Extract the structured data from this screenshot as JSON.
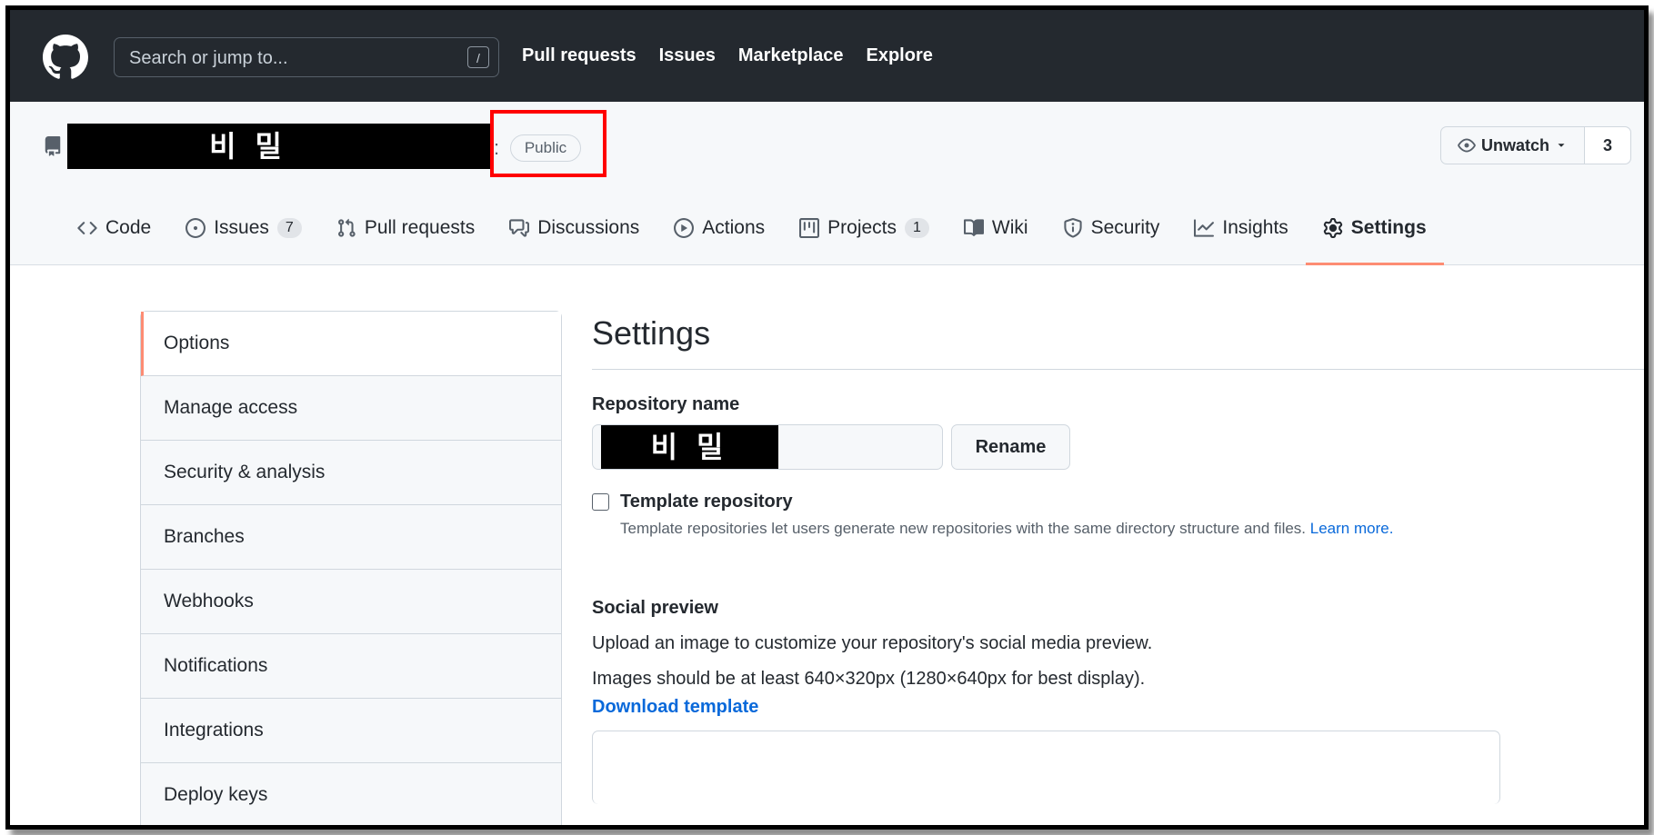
{
  "topbar": {
    "search_placeholder": "Search or jump to...",
    "search_shortcut": "/",
    "nav": [
      "Pull requests",
      "Issues",
      "Marketplace",
      "Explore"
    ]
  },
  "repo": {
    "name_redacted": "비 밀",
    "visibility": "Public",
    "watch_label": "Unwatch",
    "watch_count": "3"
  },
  "tabs": [
    {
      "label": "Code"
    },
    {
      "label": "Issues",
      "count": "7"
    },
    {
      "label": "Pull requests"
    },
    {
      "label": "Discussions"
    },
    {
      "label": "Actions"
    },
    {
      "label": "Projects",
      "count": "1"
    },
    {
      "label": "Wiki"
    },
    {
      "label": "Security"
    },
    {
      "label": "Insights"
    },
    {
      "label": "Settings"
    }
  ],
  "sidebar": {
    "items": [
      "Options",
      "Manage access",
      "Security & analysis",
      "Branches",
      "Webhooks",
      "Notifications",
      "Integrations",
      "Deploy keys"
    ]
  },
  "main": {
    "title": "Settings",
    "repo_name_label": "Repository name",
    "repo_name_value": "비 밀",
    "rename_button": "Rename",
    "template_label": "Template repository",
    "template_help": "Template repositories let users generate new repositories with the same directory structure and files.",
    "template_learn_more": "Learn more.",
    "social_label": "Social preview",
    "social_desc": "Upload an image to customize your repository's social media preview.",
    "social_size": "Images should be at least 640×320px (1280×640px for best display).",
    "download_template": "Download template"
  },
  "colors": {
    "header_bg": "#24292f",
    "active_tab_underline": "#fd8c73",
    "highlight_box": "#ff0000",
    "link": "#0969da"
  }
}
